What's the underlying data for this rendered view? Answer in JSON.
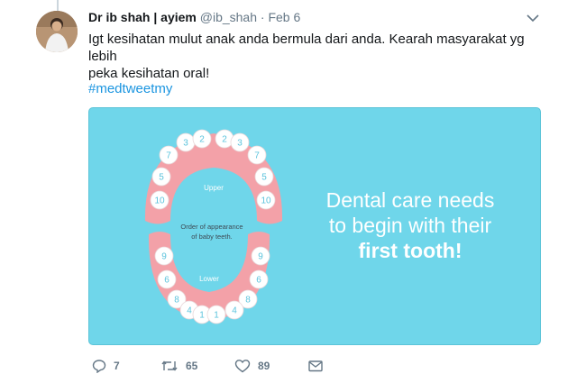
{
  "author": {
    "name": "Dr ib shah | ayiem",
    "handle": "@ib_shah",
    "separator": "·",
    "date": "Feb 6"
  },
  "tweet": {
    "text_line1": "Igt kesihatan mulut anak anda bermula dari anda. Kearah masyarakat yg lebih",
    "text_line2": "peka kesihatan oral!",
    "hashtag": "#medtweetmy"
  },
  "media": {
    "caption_line1": "Dental care needs",
    "caption_line2": "to begin with their",
    "caption_line3": "first tooth!",
    "upper_label": "Upper",
    "lower_label": "Lower",
    "center_line1": "Order of appearance",
    "center_line2": "of baby teeth.",
    "upper_teeth": [
      "3",
      "2",
      "2",
      "3",
      "7",
      "7",
      "5",
      "5",
      "10",
      "10"
    ],
    "lower_teeth": [
      "9",
      "9",
      "6",
      "6",
      "8",
      "8",
      "4",
      "4",
      "1",
      "1"
    ],
    "colors": {
      "background": "#6fd6ea",
      "gum": "#f3a1a8",
      "tooth": "#ffffff",
      "number": "#5bc3dc"
    }
  },
  "actions": {
    "replies": "7",
    "retweets": "65",
    "likes": "89"
  }
}
